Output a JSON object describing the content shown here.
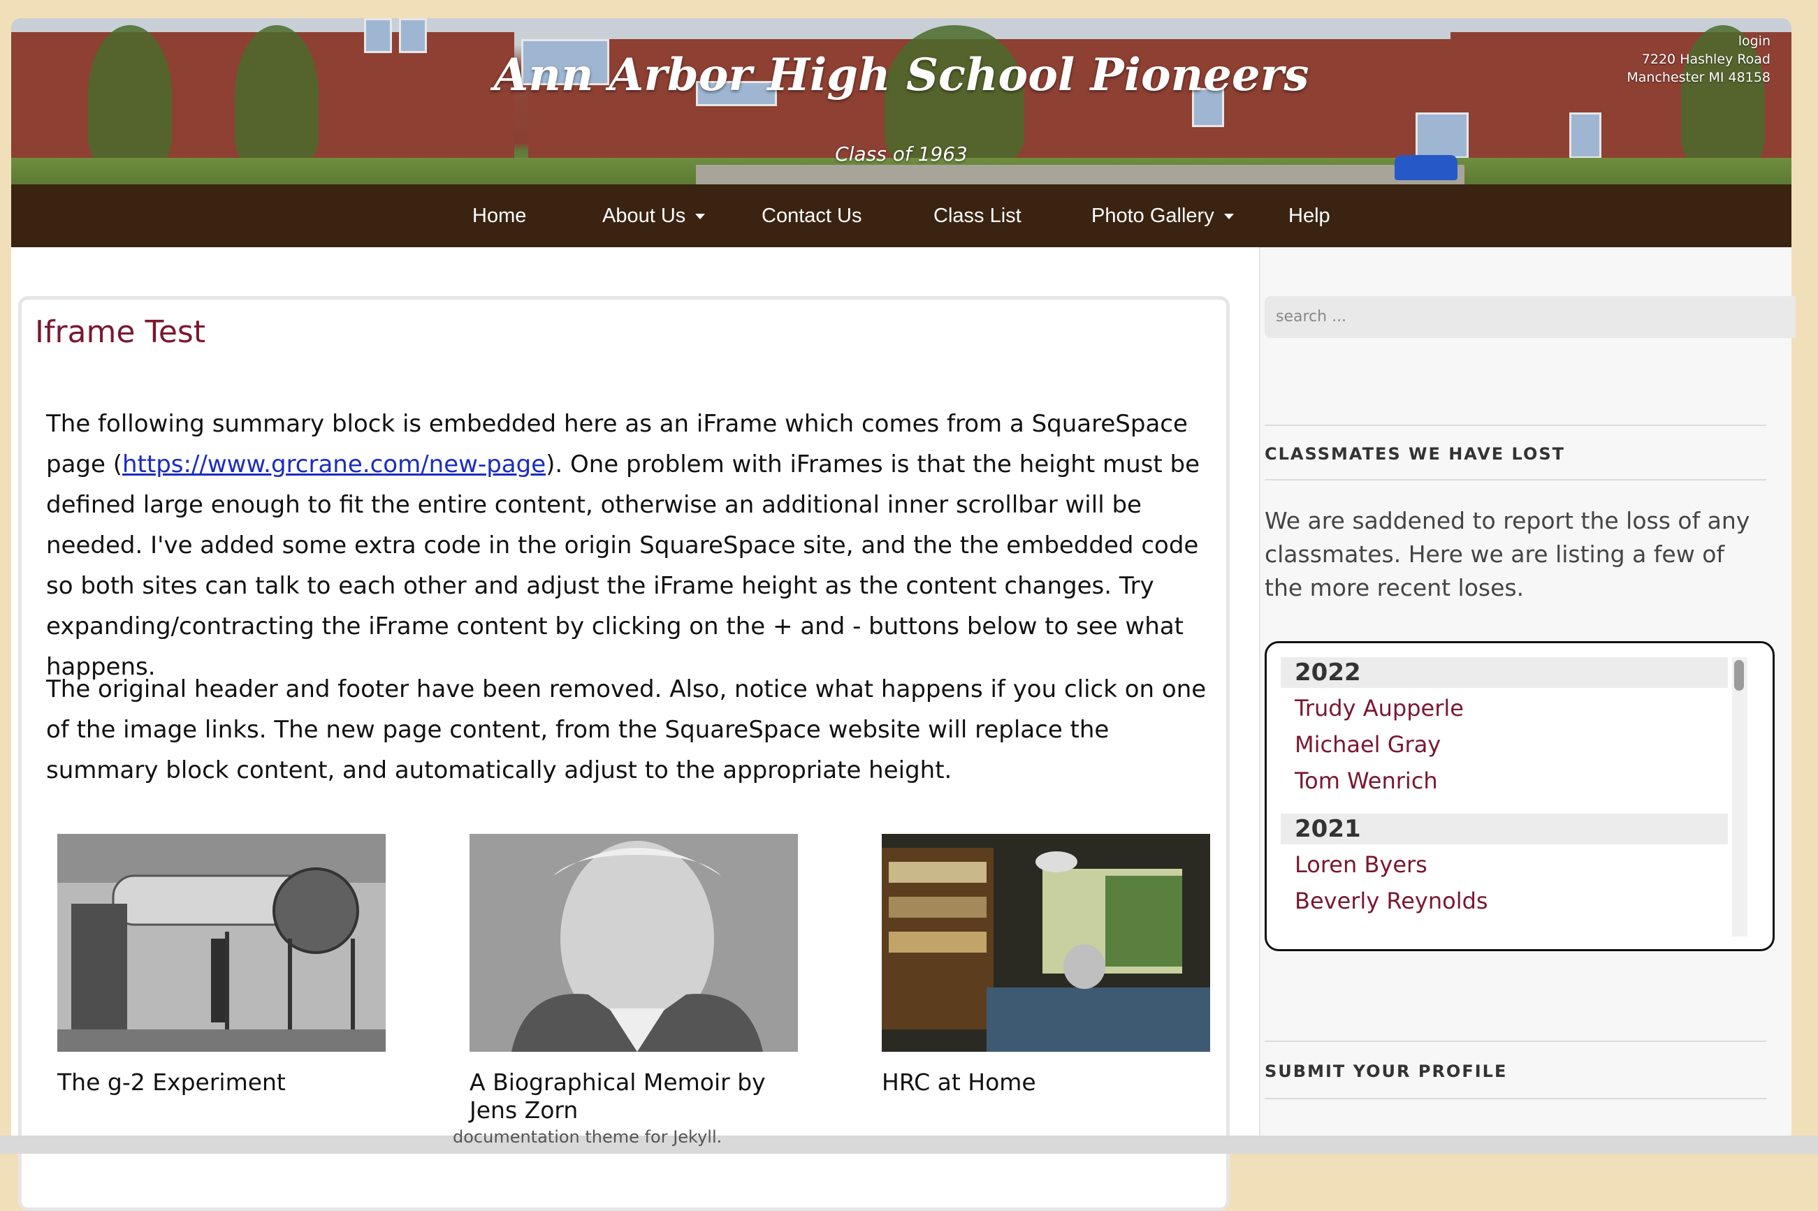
{
  "header": {
    "title": "Ann Arbor High School Pioneers",
    "subtitle": "Class of 1963",
    "login": "login",
    "address_line1": "7220 Hashley Road",
    "address_line2": "Manchester MI 48158"
  },
  "nav": {
    "items": [
      {
        "label": "Home"
      },
      {
        "label": "About Us"
      },
      {
        "label": "Contact Us"
      },
      {
        "label": "Class List"
      },
      {
        "label": "Photo Gallery"
      },
      {
        "label": "Help"
      }
    ]
  },
  "main": {
    "title": "Iframe Test",
    "p1_start": "The following summary block is embedded here as an iFrame which comes from a SquareSpace page (",
    "p1_link": "https://www.grcrane.com/new-page",
    "p1_end": ").  One problem with iFrames is that the height must be defined large enough to fit the entire content, otherwise an additional inner scrollbar will be needed.  I've added some extra code in the origin SquareSpace site, and the the embedded code so both sites can talk to each other and adjust the iFrame height as the content changes.   Try expanding/contracting the iFrame content by clicking on the + and - buttons below to see what happens.",
    "p2": "The original header and footer have been removed.   Also, notice what happens if you click on one of the image links.   The new page content, from the SquareSpace website will replace the summary block content, and automatically adjust to the appropriate height.",
    "cards": [
      {
        "caption": "The g-2 Experiment"
      },
      {
        "caption": "A Biographical Memoir by Jens Zorn"
      },
      {
        "caption": "HRC at Home"
      }
    ]
  },
  "sidebar": {
    "search_placeholder": "search ...",
    "lost_title": "CLASSMATES WE HAVE LOST",
    "lost_text": "We are saddened to report the loss of any classmates. Here we are listing a few of the more recent loses.",
    "lost": [
      {
        "year": "2022",
        "names": [
          "Trudy Aupperle",
          "Michael Gray",
          "Tom Wenrich"
        ]
      },
      {
        "year": "2021",
        "names": [
          "Loren Byers",
          "Beverly Reynolds"
        ]
      }
    ],
    "submit_title": "SUBMIT YOUR PROFILE"
  },
  "footer": {
    "partial_text": "documentation theme for Jekyll."
  }
}
